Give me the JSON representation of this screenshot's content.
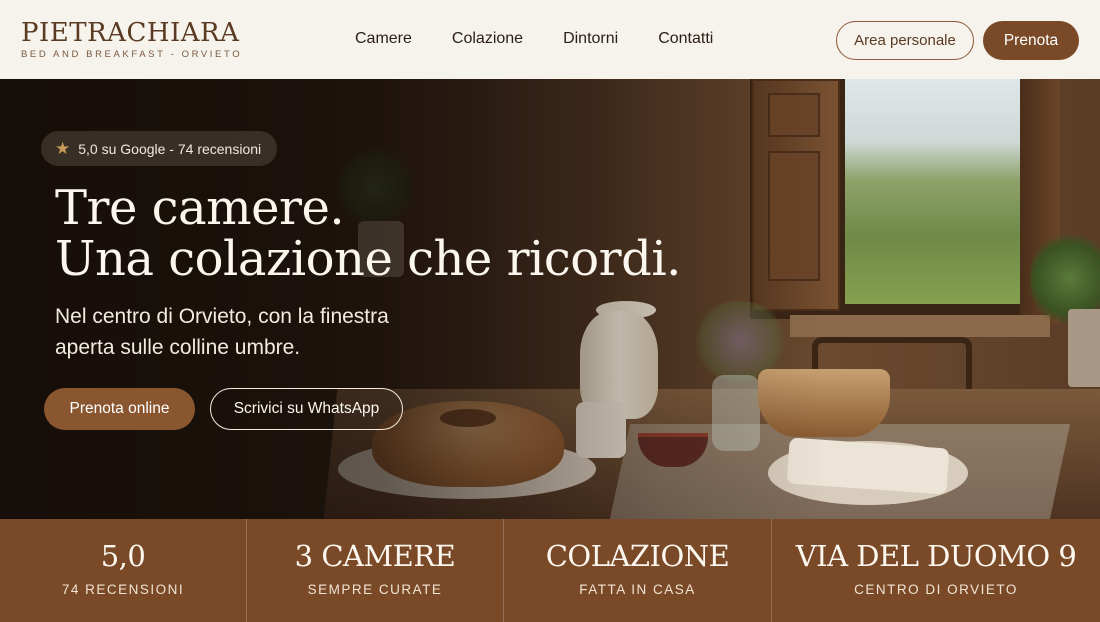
{
  "brand": {
    "name": "PIETRACHIARA",
    "tagline": "BED AND BREAKFAST - ORVIETO"
  },
  "nav": {
    "items": [
      {
        "label": "Camere"
      },
      {
        "label": "Colazione"
      },
      {
        "label": "Dintorni"
      },
      {
        "label": "Contatti"
      }
    ]
  },
  "header": {
    "account_label": "Area personale",
    "book_label": "Prenota"
  },
  "hero": {
    "rating_text": "5,0 su Google - 74 recensioni",
    "title_line1": "Tre camere.",
    "title_line2": "Una colazione che ricordi.",
    "subtitle_line1": "Nel centro di Orvieto, con la finestra",
    "subtitle_line2": "aperta sulle colline umbre.",
    "book_online_label": "Prenota online",
    "whatsapp_label": "Scrivici su WhatsApp"
  },
  "stats": [
    {
      "value": "5,0",
      "label": "74 RECENSIONI"
    },
    {
      "value": "3 CAMERE",
      "label": "SEMPRE CURATE"
    },
    {
      "value": "COLAZIONE",
      "label": "FATTA IN CASA"
    },
    {
      "value": "VIA DEL DUOMO 9",
      "label": "CENTRO DI ORVIETO"
    }
  ],
  "colors": {
    "accent": "#7a4a28",
    "header_bg": "#f6f2ec"
  },
  "icons": {
    "rating": "star-icon"
  }
}
